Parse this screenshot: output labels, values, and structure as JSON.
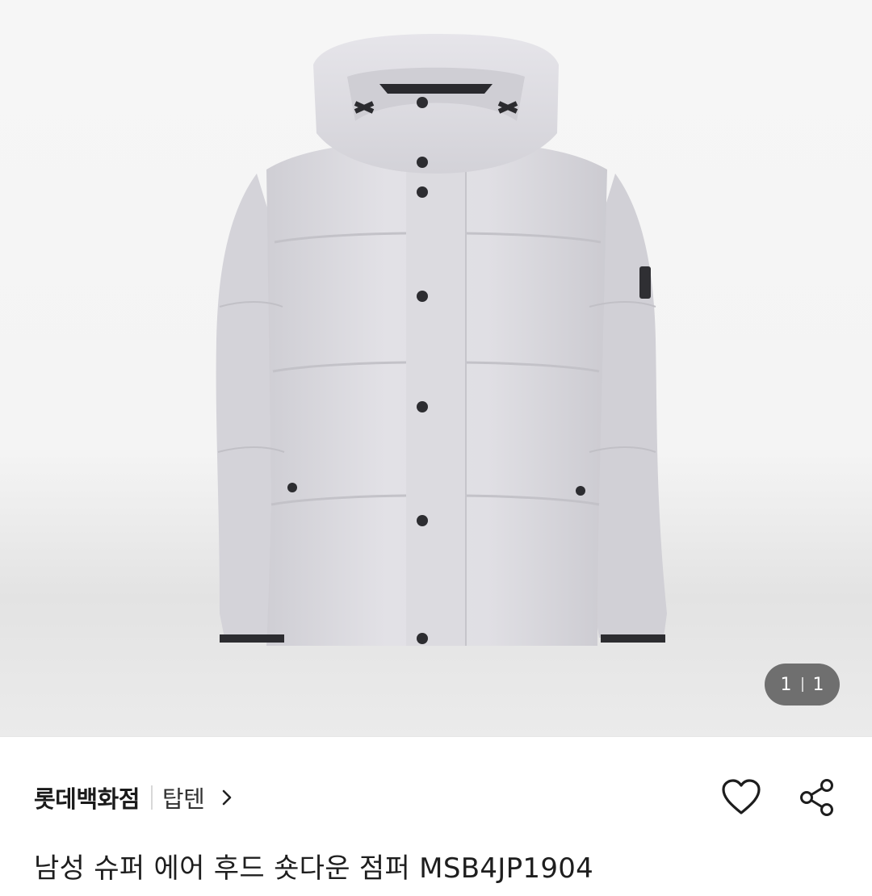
{
  "gallery": {
    "current": "1",
    "total": "1",
    "image_alt": "light grey hooded puffer jacket",
    "product_color": "#d9d8dd"
  },
  "seller": {
    "store_name": "롯데백화점",
    "brand_name": "탑텐"
  },
  "actions": {
    "like_icon": "heart-outline",
    "share_icon": "share"
  },
  "product": {
    "title": "남성 슈퍼 에어 후드 숏다운 점퍼 MSB4JP1904"
  }
}
